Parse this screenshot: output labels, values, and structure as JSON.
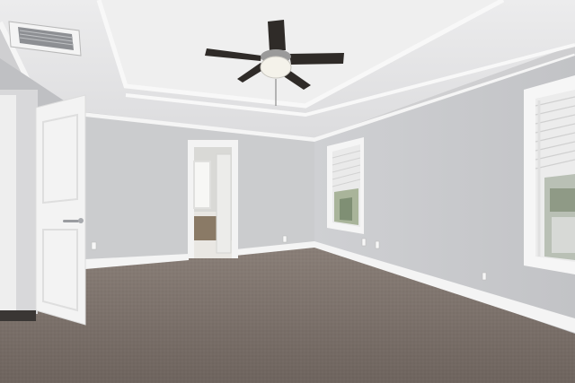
{
  "scene": {
    "kind": "interior-photo",
    "room": "empty bedroom",
    "elements": [
      "tray-ceiling-with-crown-molding",
      "ceiling-fan-with-light",
      "air-vent",
      "open-white-door",
      "doorway-to-bathroom",
      "window-with-blinds",
      "carpet-floor",
      "baseboards",
      "wall-outlets"
    ]
  },
  "colors": {
    "ceiling": "#e9e9ea",
    "wall_left": "#c4c5c8",
    "wall_back": "#cdced1",
    "wall_right": "#c8c9cc",
    "trim": "#f6f6f6",
    "door": "#f3f3f3",
    "carpet": "#7d726c",
    "fan_blade": "#2f2b28",
    "bathroom_tile": "#8a7a66"
  }
}
